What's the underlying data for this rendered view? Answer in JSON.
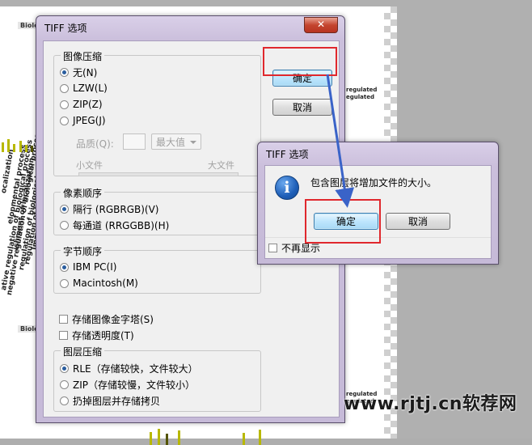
{
  "background": {
    "label_top": "Biolo",
    "label_mid": "Biolo",
    "right_labels": [
      "regulated",
      "egulated",
      "regulated",
      "egulated"
    ],
    "rotated_lines": [
      "ocalization",
      "elopmental process",
      "ishment of localization",
      "regulation of biological process",
      "regulation of biological process",
      "ative regulation of biological process",
      "negative regulation of biological process"
    ],
    "rotated_short": "Imm"
  },
  "main_dialog": {
    "title": "TIFF 选项",
    "close_glyph": "✕",
    "image_compression": {
      "title": "图像压缩",
      "options": [
        {
          "label": "无(N)",
          "selected": true
        },
        {
          "label": "LZW(L)",
          "selected": false
        },
        {
          "label": "ZIP(Z)",
          "selected": false
        },
        {
          "label": "JPEG(J)",
          "selected": false
        }
      ],
      "quality_label": "品质(Q):",
      "quality_select": "最大值",
      "small_file": "小文件",
      "large_file": "大文件"
    },
    "pixel_order": {
      "title": "像素顺序",
      "options": [
        {
          "label": "隔行 (RGBRGB)(V)",
          "selected": true
        },
        {
          "label": "每通道 (RRGGBB)(H)",
          "selected": false
        }
      ]
    },
    "byte_order": {
      "title": "字节顺序",
      "options": [
        {
          "label": "IBM PC(I)",
          "selected": true
        },
        {
          "label": "Macintosh(M)",
          "selected": false
        }
      ]
    },
    "checkboxes": [
      {
        "label": "存储图像金字塔(S)",
        "checked": false
      },
      {
        "label": "存储透明度(T)",
        "checked": false
      }
    ],
    "layer_compression": {
      "title": "图层压缩",
      "options": [
        {
          "label": "RLE（存储较快，文件较大）",
          "selected": true
        },
        {
          "label": "ZIP（存储较慢，文件较小）",
          "selected": false
        },
        {
          "label": "扔掉图层并存储拷贝",
          "selected": false
        }
      ]
    },
    "ok_label": "确定",
    "cancel_label": "取消"
  },
  "alert_dialog": {
    "title": "TIFF 选项",
    "icon": "i",
    "message": "包含图层将增加文件的大小。",
    "ok_label": "确定",
    "cancel_label": "取消",
    "dont_show_label": "不再显示",
    "dont_show_checked": false
  },
  "annotation": {
    "highlight_color": "#e0282d",
    "arrow_color": "#3a63c8"
  },
  "watermark": "www.rjtj.cn软荐网"
}
